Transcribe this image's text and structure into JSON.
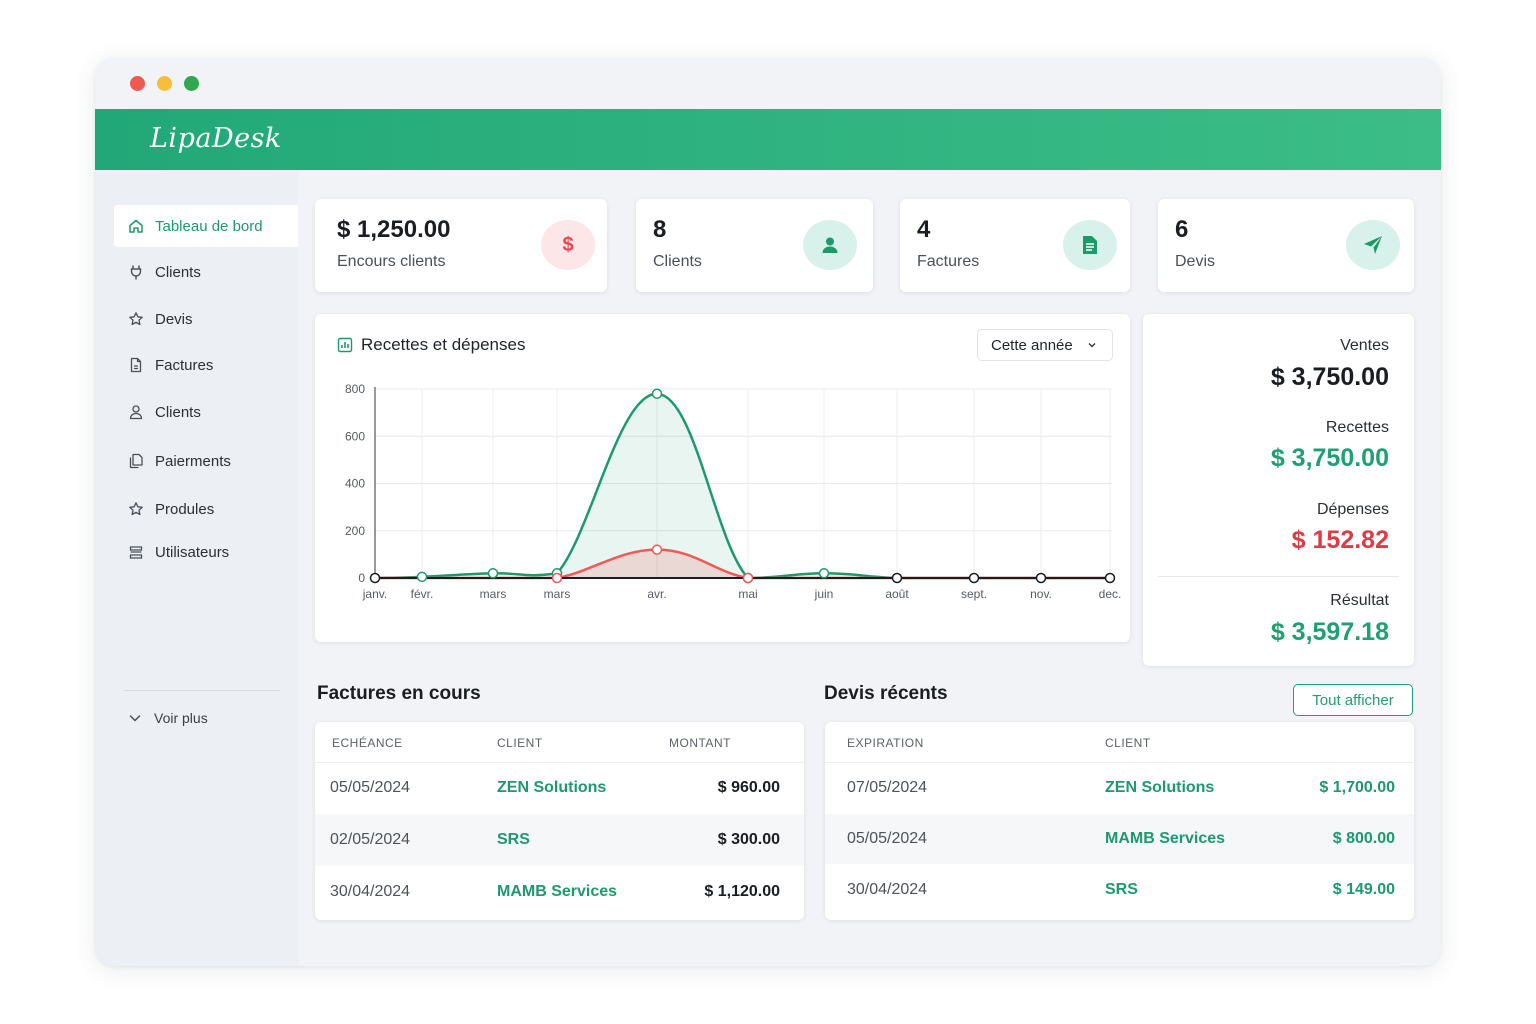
{
  "app": {
    "logo": "LipaDesk"
  },
  "sidebar": {
    "items": [
      {
        "label": "Tableau de bord",
        "icon": "home-icon",
        "active": true
      },
      {
        "label": "Clients",
        "icon": "plug-icon"
      },
      {
        "label": "Devis",
        "icon": "star-icon"
      },
      {
        "label": "Factures",
        "icon": "document-icon"
      },
      {
        "label": "Clients",
        "icon": "user-icon"
      },
      {
        "label": "Paierments",
        "icon": "copy-icon"
      },
      {
        "label": "Produles",
        "icon": "star-icon"
      },
      {
        "label": "Utilisateurs",
        "icon": "stack-icon"
      }
    ],
    "more_label": "Voir plus"
  },
  "stats": [
    {
      "value": "$ 1,250.00",
      "label": "Encours clients",
      "icon": "dollar-icon",
      "color": "#e8474f"
    },
    {
      "value": "8",
      "label": "Clients",
      "icon": "user-icon",
      "color": "#1d9a6c"
    },
    {
      "value": "4",
      "label": "Factures",
      "icon": "document-icon",
      "color": "#1d9a6c"
    },
    {
      "value": "6",
      "label": "Devis",
      "icon": "paper-plane-icon",
      "color": "#1d9a6c"
    }
  ],
  "chart_panel": {
    "title": "Recettes et dépenses",
    "period_select": "Cette année"
  },
  "chart_data": {
    "type": "area",
    "title": "Recettes et dépenses",
    "categories": [
      "janv.",
      "févr.",
      "mars",
      "mars",
      "avr.",
      "mai",
      "juin",
      "août",
      "sept.",
      "nov.",
      "dec."
    ],
    "series": [
      {
        "values": [
          0,
          5,
          20,
          20,
          780,
          0,
          20,
          0,
          0,
          0,
          0
        ],
        "color": "#1d9a6c"
      },
      {
        "values": [
          0,
          0,
          0,
          0,
          120,
          0,
          0,
          0,
          0,
          0,
          0
        ],
        "color": "#ee5a5a"
      }
    ],
    "yticks": [
      0,
      200,
      400,
      600,
      800
    ],
    "ylim": [
      0,
      800
    ],
    "grid": true
  },
  "summary": {
    "ventes_label": "Ventes",
    "ventes_value": "$ 3,750.00",
    "recettes_label": "Recettes",
    "recettes_value": "$ 3,750.00",
    "depenses_label": "Dépenses",
    "depenses_value": "$ 152.82",
    "resultat_label": "Résultat",
    "resultat_value": "$ 3,597.18",
    "colors": {
      "dark": "#1a1d21",
      "green": "#1fa070",
      "red": "#e03b45"
    }
  },
  "invoices": {
    "title": "Factures en cours",
    "headers": [
      "ECHÉANCE",
      "CLIENT",
      "MONTANT"
    ],
    "rows": [
      {
        "date": "05/05/2024",
        "client": "ZEN Solutions",
        "amount": "$ 960.00"
      },
      {
        "date": "02/05/2024",
        "client": "SRS",
        "amount": "$ 300.00"
      },
      {
        "date": "30/04/2024",
        "client": "MAMB Services",
        "amount": "$ 1,120.00"
      }
    ]
  },
  "quotes": {
    "title": "Devis récents",
    "button": "Tout afficher",
    "headers": [
      "EXPIRATION",
      "CLIENT"
    ],
    "rows": [
      {
        "date": "07/05/2024",
        "client": "ZEN Solutions",
        "amount": "$ 1,700.00"
      },
      {
        "date": "05/05/2024",
        "client": "MAMB Services",
        "amount": "$ 800.00"
      },
      {
        "date": "30/04/2024",
        "client": "SRS",
        "amount": "$ 149.00"
      }
    ]
  }
}
